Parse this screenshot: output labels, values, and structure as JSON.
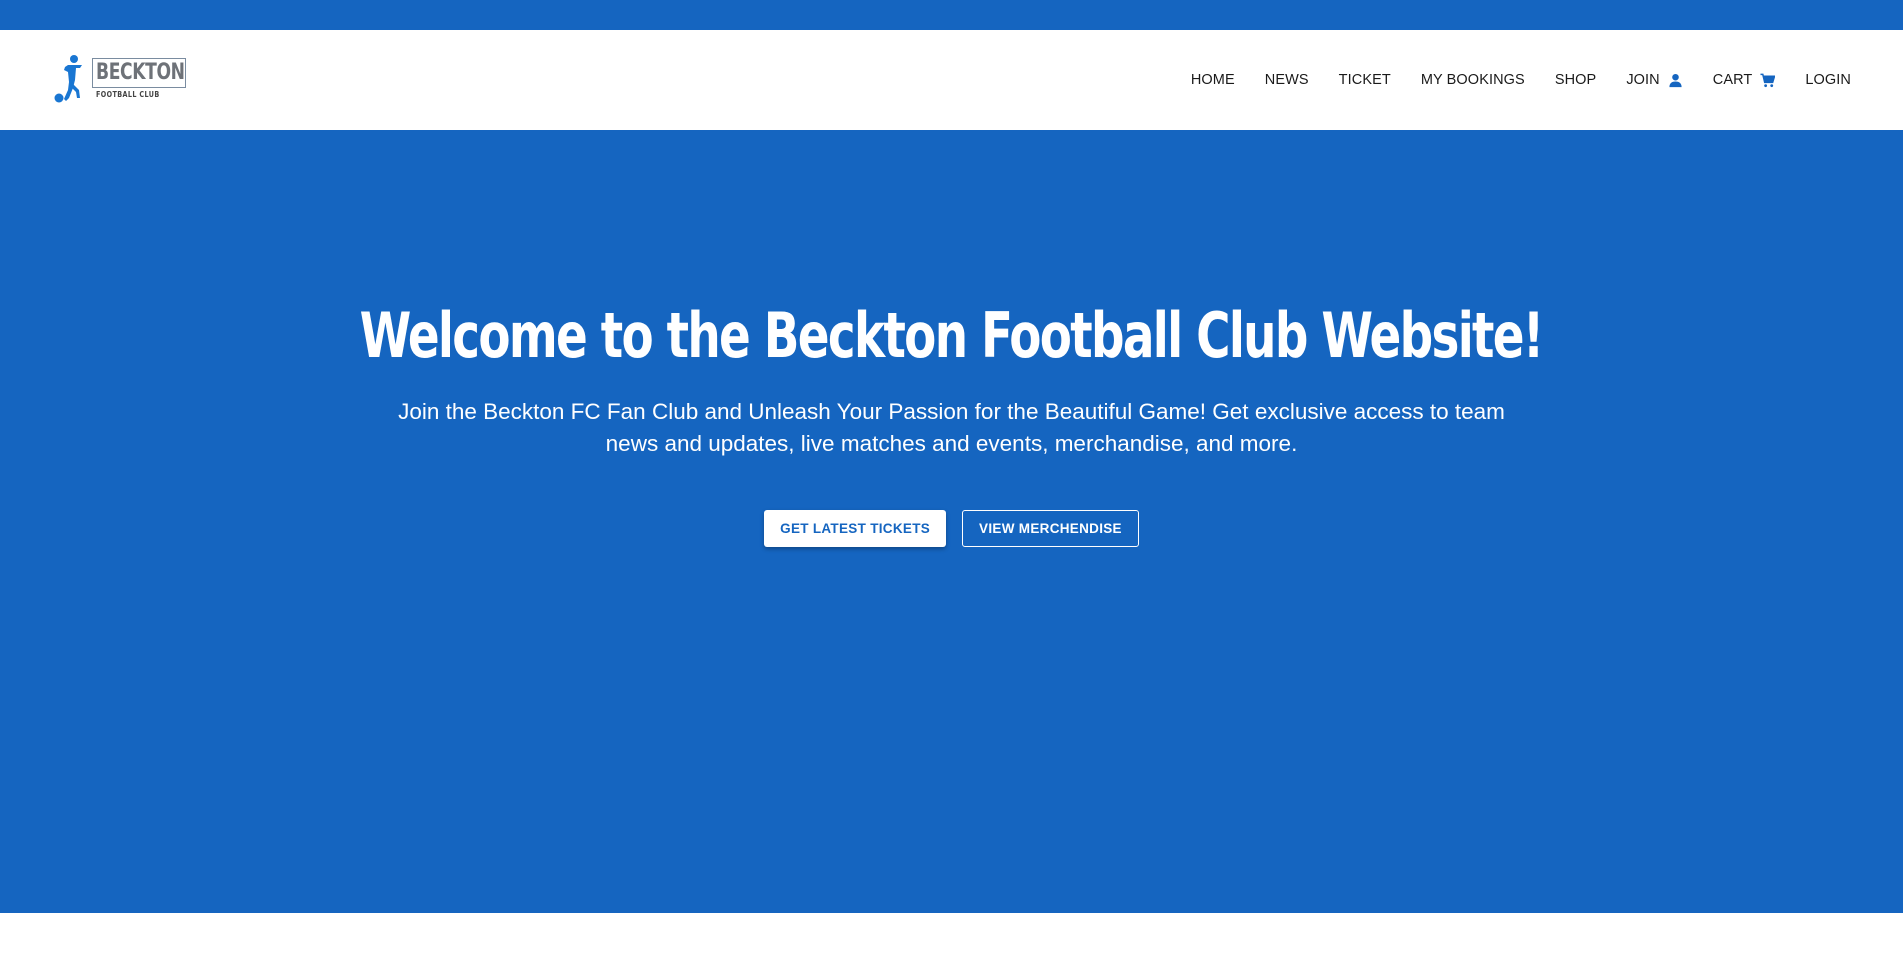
{
  "brand": {
    "name": "BECKTON",
    "tagline": "FOOTBALL CLUB",
    "color": "#1565c0"
  },
  "nav": {
    "items": [
      {
        "label": "HOME"
      },
      {
        "label": "NEWS"
      },
      {
        "label": "TICKET"
      },
      {
        "label": "MY BOOKINGS"
      },
      {
        "label": "SHOP"
      },
      {
        "label": "JOIN",
        "icon": "person-icon"
      },
      {
        "label": "CART",
        "icon": "cart-icon"
      },
      {
        "label": "LOGIN"
      }
    ]
  },
  "hero": {
    "title": "Welcome to the Beckton Football Club Website!",
    "subtitle": "Join the Beckton FC Fan Club and Unleash Your Passion for the Beautiful Game! Get exclusive access to team news and updates, live matches and events, merchandise, and more.",
    "primary_button": "GET LATEST TICKETS",
    "secondary_button": "VIEW MERCHENDISE"
  }
}
